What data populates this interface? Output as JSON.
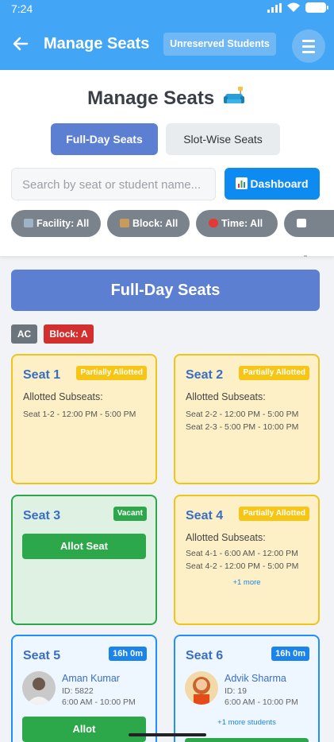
{
  "status": {
    "time": "7:24"
  },
  "appbar": {
    "title": "Manage Seats",
    "unreserved_label": "Unreserved Students"
  },
  "header": {
    "title": "Manage Seats",
    "tabs": {
      "full_day": "Full-Day Seats",
      "slot_wise": "Slot-Wise Seats"
    }
  },
  "search": {
    "placeholder": "Search by seat or student name..."
  },
  "dashboard_label": "Dashboard",
  "filters": {
    "facility": "Facility: All",
    "block": "Block: All",
    "time": "Time: All"
  },
  "section": {
    "banner": "Full-Day Seats",
    "tags": {
      "ac": "AC",
      "block": "Block: A"
    }
  },
  "seats": [
    {
      "name": "Seat 1",
      "status": "Partially Allotted",
      "allotted_label": "Allotted Subseats:",
      "subseats": [
        "Seat 1-2 - 12:00 PM - 5:00 PM"
      ]
    },
    {
      "name": "Seat 2",
      "status": "Partially Allotted",
      "allotted_label": "Allotted Subseats:",
      "subseats": [
        "Seat 2-2 - 12:00 PM - 5:00 PM",
        "Seat 2-3 - 5:00 PM - 10:00 PM"
      ]
    },
    {
      "name": "Seat 3",
      "status": "Vacant",
      "action": "Allot Seat"
    },
    {
      "name": "Seat 4",
      "status": "Partially Allotted",
      "allotted_label": "Allotted Subseats:",
      "subseats": [
        "Seat 4-1 - 6:00 AM - 12:00 PM",
        "Seat 4-2 - 12:00 PM - 5:00 PM"
      ],
      "more": "+1 more"
    },
    {
      "name": "Seat 5",
      "status": "16h 0m",
      "student": {
        "name": "Aman Kumar",
        "id": "ID: 5822",
        "time": "6:00 AM - 10:00 PM"
      },
      "action": "Allot"
    },
    {
      "name": "Seat 6",
      "status": "16h 0m",
      "student": {
        "name": "Advik Sharma",
        "id": "ID: 19",
        "time": "6:00 AM - 10:00 PM"
      },
      "more": "+1 more students"
    }
  ],
  "colors": {
    "primary": "#42a5f5",
    "accent": "#5c7fd1",
    "partial": "#f7c513",
    "vacant": "#2ca84a",
    "occupied": "#1e90ff"
  }
}
